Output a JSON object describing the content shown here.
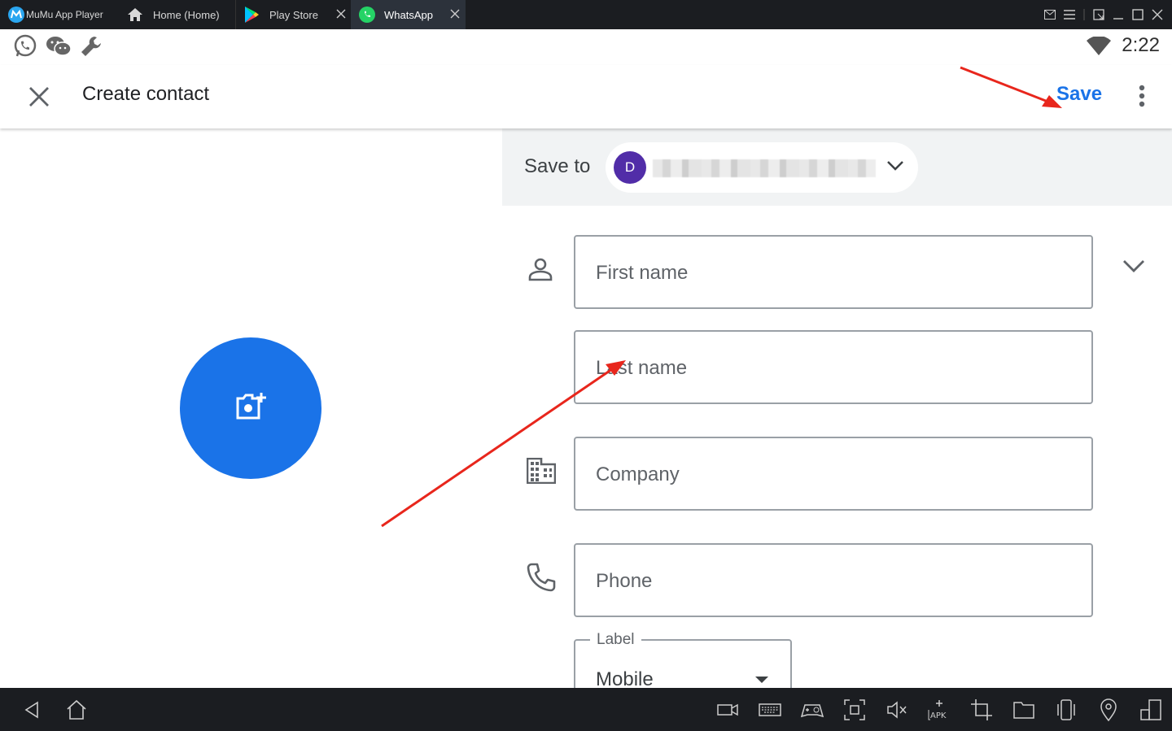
{
  "titlebar": {
    "tabs": [
      {
        "label": "MuMu App Player"
      },
      {
        "label": "Home (Home)"
      },
      {
        "label": "Play Store"
      },
      {
        "label": "WhatsApp"
      }
    ]
  },
  "statusbar": {
    "time": "2:22"
  },
  "appbar": {
    "title": "Create contact",
    "save_label": "Save"
  },
  "saveto": {
    "label": "Save to",
    "account_initial": "D"
  },
  "fields": {
    "first_name": "First name",
    "last_name": "Last name",
    "company": "Company",
    "phone": "Phone",
    "label_legend": "Label",
    "label_value": "Mobile"
  },
  "colors": {
    "accent": "#1a73e8",
    "avatar": "#512da8",
    "arrow": "#e8261c"
  }
}
